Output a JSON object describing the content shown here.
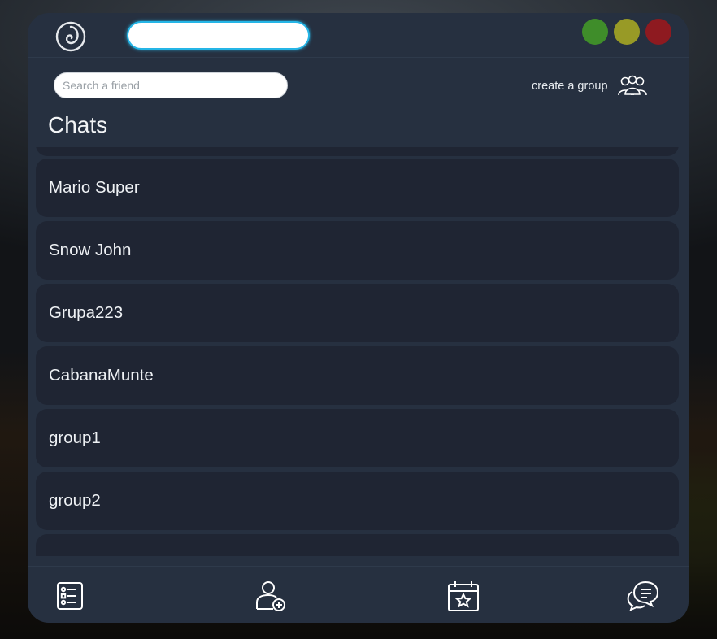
{
  "window": {
    "title_value": "",
    "controls": {
      "minimize_color": "#3f8d2a",
      "maximize_color": "#989a26",
      "close_color": "#8e1a20"
    }
  },
  "search": {
    "placeholder": "Search a friend",
    "value": ""
  },
  "create_group": {
    "label": "create a group",
    "icon": "group-icon"
  },
  "chats": {
    "title": "Chats",
    "items": [
      {
        "label": ""
      },
      {
        "label": "Mario Super"
      },
      {
        "label": "Snow John"
      },
      {
        "label": "Grupa223"
      },
      {
        "label": "CabanaMunte"
      },
      {
        "label": "group1"
      },
      {
        "label": "group2"
      },
      {
        "label": ""
      }
    ]
  },
  "bottom_nav": {
    "items": [
      {
        "icon": "task-list-icon"
      },
      {
        "icon": "add-friend-icon"
      },
      {
        "icon": "calendar-star-icon"
      },
      {
        "icon": "chat-bubbles-icon"
      }
    ]
  },
  "colors": {
    "accent": "#25b5e6",
    "panel": "#263040",
    "row": "#1f2533",
    "text": "#eef1f4"
  }
}
